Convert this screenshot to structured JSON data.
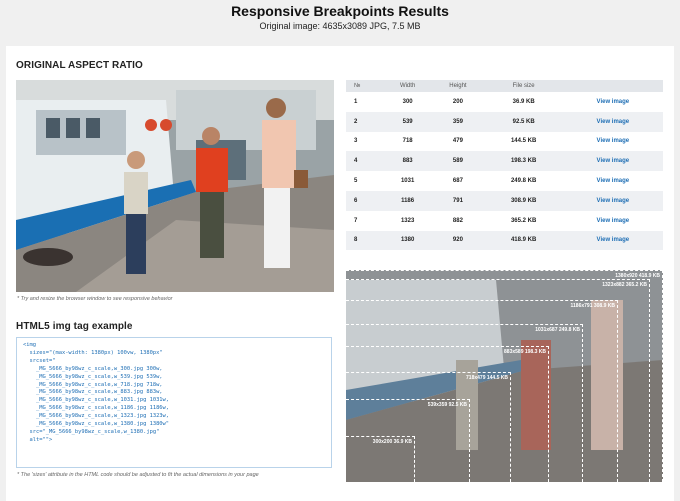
{
  "header": {
    "title": "Responsive Breakpoints Results",
    "subtitle": "Original image: 4635x3089 JPG, 7.5 MB"
  },
  "aspect_section": {
    "title": "ORIGINAL ASPECT RATIO",
    "note": "* Try and resize the browser window to see responsive behavior"
  },
  "table": {
    "headers": [
      "№",
      "Width",
      "Height",
      "File size",
      ""
    ],
    "link_label": "View image",
    "rows": [
      {
        "n": "1",
        "w": "300",
        "h": "200",
        "size": "36.9 KB"
      },
      {
        "n": "2",
        "w": "539",
        "h": "359",
        "size": "92.5 KB"
      },
      {
        "n": "3",
        "w": "718",
        "h": "479",
        "size": "144.5 KB"
      },
      {
        "n": "4",
        "w": "883",
        "h": "589",
        "size": "198.3 KB"
      },
      {
        "n": "5",
        "w": "1031",
        "h": "687",
        "size": "249.8 KB"
      },
      {
        "n": "6",
        "w": "1186",
        "h": "791",
        "size": "308.9 KB"
      },
      {
        "n": "7",
        "w": "1323",
        "h": "882",
        "size": "365.2 KB"
      },
      {
        "n": "8",
        "w": "1380",
        "h": "920",
        "size": "418.9 KB"
      }
    ]
  },
  "html5": {
    "title": "HTML5 img tag example",
    "note": "* The 'sizes' attribute in the HTML code should be adjusted to fit the actual dimensions in your page",
    "code_lines": [
      "<img",
      "  sizes=\"(max-width: 1380px) 100vw, 1380px\"",
      "  srcset=\"",
      "    _MG_5666_by98wz_c_scale,w_300.jpg 300w,",
      "    _MG_5666_by98wz_c_scale,w_539.jpg 539w,",
      "    _MG_5666_by98wz_c_scale,w_718.jpg 718w,",
      "    _MG_5666_by98wz_c_scale,w_883.jpg 883w,",
      "    _MG_5666_by98wz_c_scale,w_1031.jpg 1031w,",
      "    _MG_5666_by98wz_c_scale,w_1186.jpg 1186w,",
      "    _MG_5666_by98wz_c_scale,w_1323.jpg 1323w,",
      "    _MG_5666_by98wz_c_scale,w_1380.jpg 1380w\"",
      "  src=\"_MG_5666_by98wz_c_scale,w_1380.jpg\"",
      "  alt=\"\">"
    ]
  },
  "visual_labels": [
    "300x200 36.9 KB",
    "539x359 92.5 KB",
    "718x479 144.5 KB",
    "883x589 198.3 KB",
    "1031x687 249.8 KB",
    "1186x791 308.9 KB",
    "1323x882 365.2 KB",
    "1380x920 418.9 KB"
  ],
  "colors": {
    "link": "#1f6fb5",
    "card_bg": "#ffffff",
    "page_bg": "#f0f0f0",
    "table_header": "#e3e6ea"
  }
}
